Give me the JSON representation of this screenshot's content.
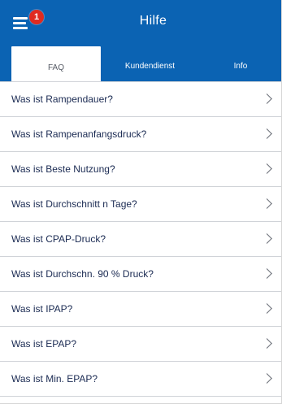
{
  "header": {
    "title": "Hilfe",
    "notification_count": "1"
  },
  "tabs": [
    {
      "label": "FAQ",
      "active": true
    },
    {
      "label": "Kundendienst",
      "active": false
    },
    {
      "label": "Info",
      "active": false
    }
  ],
  "faq_items": [
    {
      "label": "Was ist Rampendauer?"
    },
    {
      "label": "Was ist Rampenanfangsdruck?"
    },
    {
      "label": "Was ist Beste Nutzung?"
    },
    {
      "label": "Was ist Durchschnitt n Tage?"
    },
    {
      "label": "Was ist CPAP-Druck?"
    },
    {
      "label": "Was ist Durchschn. 90 % Druck?"
    },
    {
      "label": "Was ist IPAP?"
    },
    {
      "label": "Was ist EPAP?"
    },
    {
      "label": "Was ist Min. EPAP?"
    }
  ],
  "colors": {
    "header_blue": "#0b63b3",
    "badge_red": "#e02b20",
    "list_text": "#1a2a52"
  },
  "icons": {
    "menu": "hamburger-menu-icon",
    "row_arrow": "chevron-right-icon"
  }
}
